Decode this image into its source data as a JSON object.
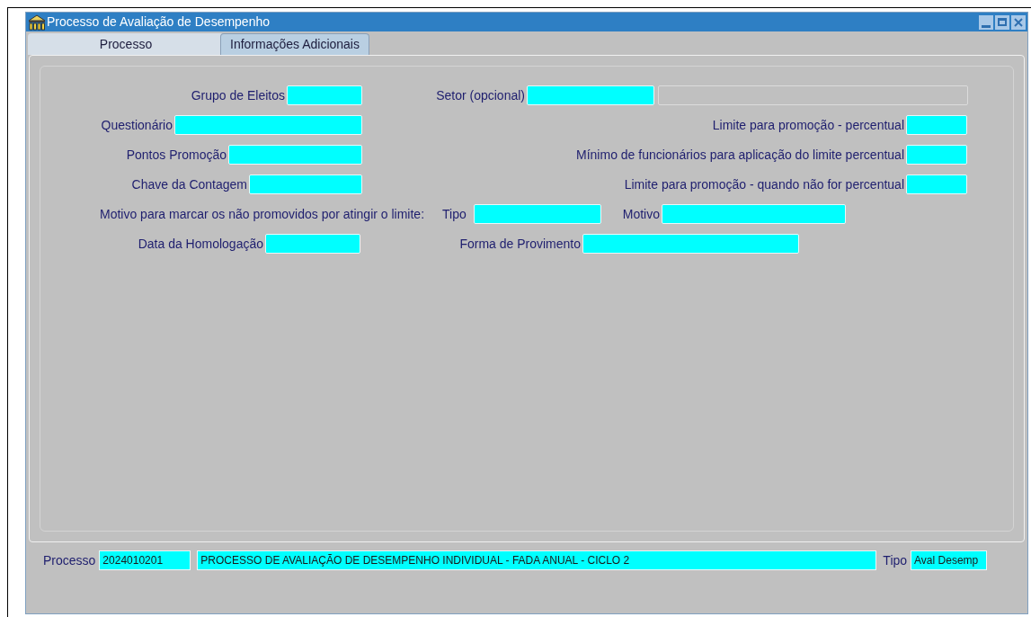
{
  "window": {
    "title": "Processo de Avaliação de Desempenho"
  },
  "tabs": [
    {
      "label": "Processo",
      "selected": false
    },
    {
      "label": "Informações Adicionais",
      "selected": true
    }
  ],
  "form": {
    "row_1": [
      {
        "label": "Grupo de Eleitos",
        "disabled": false
      },
      {
        "label": "Setor (opcional)",
        "disabled": false
      },
      {
        "disabled": true
      }
    ],
    "row_2": [
      {
        "label": "Questionário",
        "disabled": false
      },
      {
        "label": "Limite para promoção - percentual",
        "disabled": false
      }
    ],
    "row_3": [
      {
        "label": "Pontos Promoção",
        "disabled": false
      },
      {
        "label": "Mínimo de funcionários para aplicação do limite percentual",
        "disabled": false
      }
    ],
    "row_4": [
      {
        "label": "Chave da Contagem",
        "disabled": false
      },
      {
        "label": "Limite para promoção - quando não for percentual",
        "disabled": false
      }
    ],
    "row_5": {
      "heading": "Motivo para marcar os não promovidos por atingir o limite:",
      "fields": [
        {
          "label": "Tipo",
          "disabled": false
        },
        {
          "label": "Motivo",
          "disabled": false
        }
      ]
    },
    "row_6": [
      {
        "label": "Data da Homologação",
        "disabled": false
      },
      {
        "label": "Forma de Provimento",
        "disabled": false
      }
    ]
  },
  "footer": {
    "label": "Processo",
    "code": "2024010201",
    "description": "PROCESSO DE AVALIAÇÃO DE DESEMPENHO INDIVIDUAL - FADA ANUAL - CICLO 2",
    "type_label": "Tipo",
    "type": "Aval Desemp"
  }
}
